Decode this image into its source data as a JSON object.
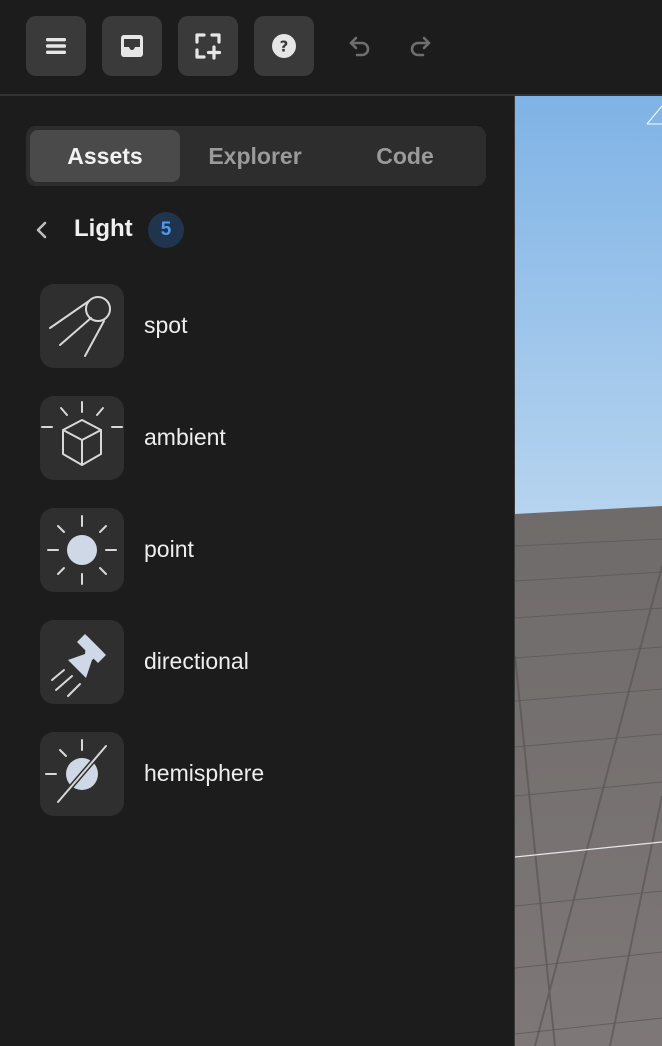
{
  "toolbar": {
    "buttons": [
      {
        "name": "menu-icon"
      },
      {
        "name": "inbox-icon"
      },
      {
        "name": "fullscreen-add-icon"
      },
      {
        "name": "help-icon"
      }
    ],
    "undo": "undo-icon",
    "redo": "redo-icon"
  },
  "tabs": [
    {
      "label": "Assets",
      "active": true
    },
    {
      "label": "Explorer",
      "active": false
    },
    {
      "label": "Code",
      "active": false
    }
  ],
  "breadcrumb": {
    "title": "Light",
    "count": "5"
  },
  "items": [
    {
      "label": "spot",
      "icon": "spotlight-icon"
    },
    {
      "label": "ambient",
      "icon": "ambient-light-icon"
    },
    {
      "label": "point",
      "icon": "point-light-icon"
    },
    {
      "label": "directional",
      "icon": "directional-light-icon"
    },
    {
      "label": "hemisphere",
      "icon": "hemisphere-light-icon"
    }
  ],
  "colors": {
    "background": "#1c1c1c",
    "button": "#3a3a3a",
    "badge_bg": "#21344d",
    "badge_text": "#4d9bf0",
    "sky": "#9cc6ec",
    "ground": "#7c7877"
  }
}
